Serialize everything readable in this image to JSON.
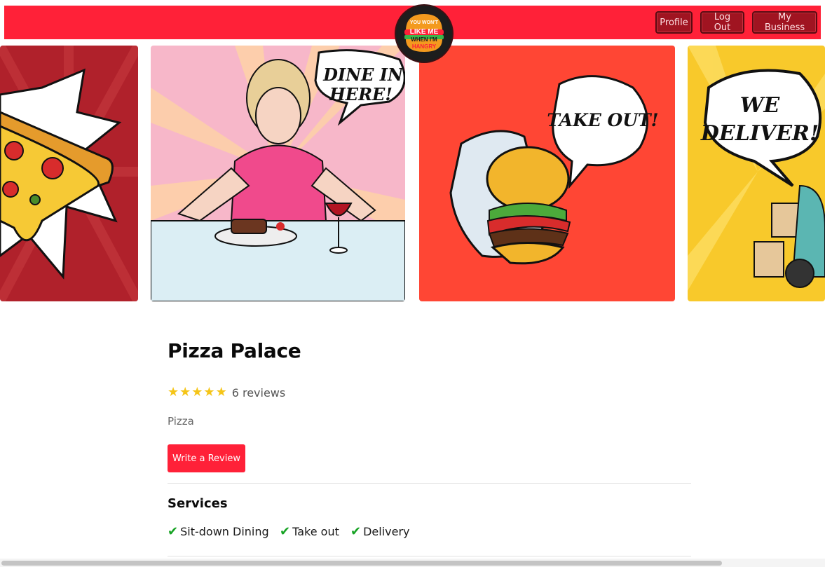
{
  "nav": {
    "logo_text": [
      "YOU WON'T",
      "LIKE ME",
      "WHEN I'M",
      "HANGRY"
    ],
    "buttons": {
      "profile": "Profile",
      "logout": "Log Out",
      "business": "My Business"
    }
  },
  "carousel": {
    "slides": [
      {
        "name": "pizza",
        "caption": ""
      },
      {
        "name": "dine-in",
        "caption_line1": "DINE IN",
        "caption_line2": "HERE!"
      },
      {
        "name": "take-out",
        "caption": "TAKE OUT!"
      },
      {
        "name": "deliver",
        "caption_line1": "WE",
        "caption_line2": "DELIVER!"
      }
    ]
  },
  "business": {
    "name": "Pizza Palace",
    "rating": 5,
    "review_count": "6 reviews",
    "category": "Pizza",
    "write_review_label": "Write a Review"
  },
  "services": {
    "title": "Services",
    "items": [
      "Sit-down Dining",
      "Take out",
      "Delivery"
    ]
  },
  "colors": {
    "brand_red": "#ff2138",
    "star": "#f5c518",
    "check": "#17a324"
  }
}
